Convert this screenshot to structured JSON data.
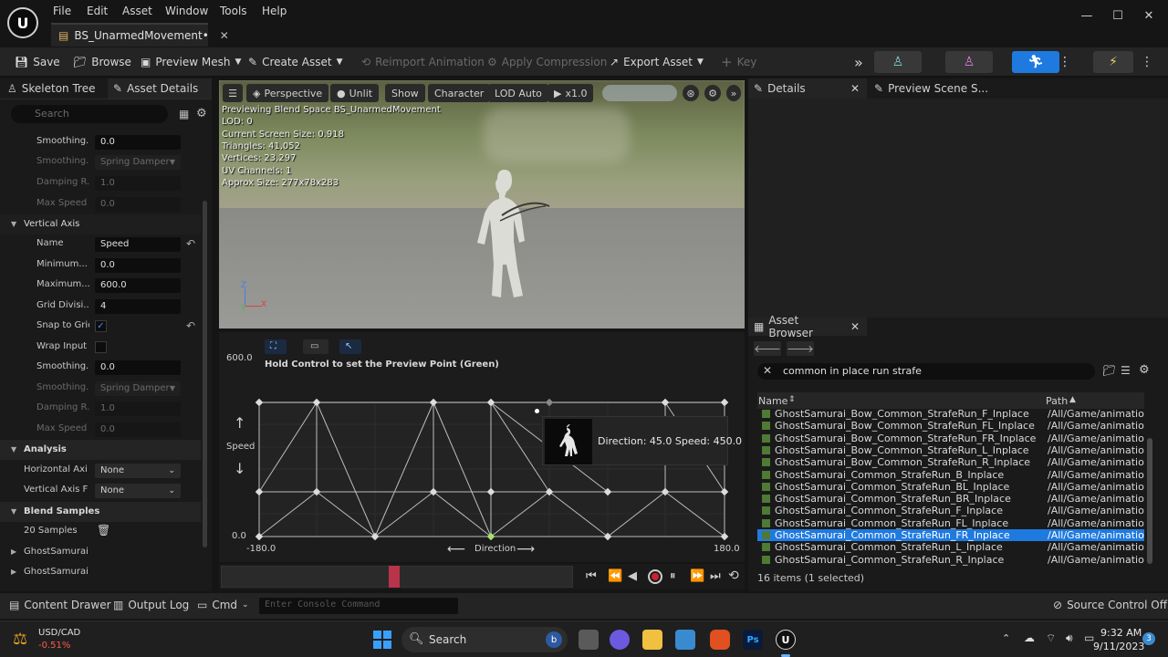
{
  "menu": [
    "File",
    "Edit",
    "Asset",
    "Window",
    "Tools",
    "Help"
  ],
  "tab": {
    "title": "BS_UnarmedMovement•"
  },
  "toolbar": {
    "save": "Save",
    "browse": "Browse",
    "preview_mesh": "Preview Mesh",
    "create_asset": "Create Asset",
    "reimport": "Reimport Animation",
    "apply_compression": "Apply Compression",
    "export_asset": "Export Asset",
    "key": "Key"
  },
  "left_panel": {
    "tab_skeleton": "Skeleton Tree",
    "tab_details": "Asset Details",
    "search_placeholder": "Search",
    "rows_top": [
      {
        "label": "Smoothing...",
        "value": "0.0",
        "dim": false,
        "kind": "num"
      },
      {
        "label": "Smoothing...",
        "value": "Spring Damper",
        "dim": true,
        "kind": "select"
      },
      {
        "label": "Damping R...",
        "value": "1.0",
        "dim": true,
        "kind": "num"
      },
      {
        "label": "Max Speed",
        "value": "0.0",
        "dim": true,
        "kind": "num"
      }
    ],
    "vertical_axis": {
      "title": "Vertical Axis",
      "name_label": "Name",
      "name_value": "Speed",
      "min_label": "Minimum...",
      "min_value": "0.0",
      "max_label": "Maximum...",
      "max_value": "600.0",
      "grid_label": "Grid Divisi...",
      "grid_value": "4",
      "snap_label": "Snap to Grid",
      "wrap_label": "Wrap Input",
      "smooth_label": "Smoothing...",
      "smooth_value": "0.0",
      "smooth2_label": "Smoothing...",
      "smooth2_value": "Spring Damper",
      "damping_label": "Damping R...",
      "damping_value": "1.0",
      "maxspeed_label": "Max Speed",
      "maxspeed_value": "0.0"
    },
    "analysis": {
      "title": "Analysis",
      "h_label": "Horizontal Axis I",
      "h_value": "None",
      "v_label": "Vertical Axis Fur",
      "v_value": "None"
    },
    "blend_samples": {
      "title": "Blend Samples",
      "count": "20 Samples",
      "item1": "GhostSamurai_(",
      "item2": "GhostSamurai_("
    }
  },
  "viewport": {
    "perspective": "Perspective",
    "unlit": "Unlit",
    "show": "Show",
    "character": "Character",
    "lod": "LOD Auto",
    "speed": "x1.0",
    "stats": [
      "Previewing Blend Space BS_UnarmedMovement",
      "LOD: 0",
      "Current Screen Size: 0.918",
      "Triangles: 41,052",
      "Vertices: 23,297",
      "UV Channels: 1",
      "Approx Size: 277x78x283"
    ],
    "axis_z": "Z",
    "axis_x": "X",
    "axis_y": "Y"
  },
  "blend_graph": {
    "hint": "Hold Control to set the Preview Point (Green)",
    "y_max": "600.0",
    "y_min": "0.0",
    "x_min": "-180.0",
    "x_max": "180.0",
    "y_axis_label": "Speed",
    "x_axis_label": "Direction",
    "tooltip": "Direction: 45.0  Speed: 450.0"
  },
  "details_panel": {
    "tab_details": "Details",
    "tab_preview": "Preview Scene S..."
  },
  "asset_browser": {
    "title": "Asset Browser",
    "search_value": "common in place run strafe",
    "col_name": "Name",
    "col_path": "Path",
    "rows": [
      {
        "name": "GhostSamurai_Bow_Common_StrafeRun_F_Inplace",
        "path": "/All/Game/animatio",
        "selected": false
      },
      {
        "name": "GhostSamurai_Bow_Common_StrafeRun_FL_Inplace",
        "path": "/All/Game/animatio",
        "selected": false
      },
      {
        "name": "GhostSamurai_Bow_Common_StrafeRun_FR_Inplace",
        "path": "/All/Game/animatio",
        "selected": false
      },
      {
        "name": "GhostSamurai_Bow_Common_StrafeRun_L_Inplace",
        "path": "/All/Game/animatio",
        "selected": false
      },
      {
        "name": "GhostSamurai_Bow_Common_StrafeRun_R_Inplace",
        "path": "/All/Game/animatio",
        "selected": false
      },
      {
        "name": "GhostSamurai_Common_StrafeRun_B_Inplace",
        "path": "/All/Game/animatio",
        "selected": false
      },
      {
        "name": "GhostSamurai_Common_StrafeRun_BL_Inplace",
        "path": "/All/Game/animatio",
        "selected": false
      },
      {
        "name": "GhostSamurai_Common_StrafeRun_BR_Inplace",
        "path": "/All/Game/animatio",
        "selected": false
      },
      {
        "name": "GhostSamurai_Common_StrafeRun_F_Inplace",
        "path": "/All/Game/animatio",
        "selected": false
      },
      {
        "name": "GhostSamurai_Common_StrafeRun_FL_Inplace",
        "path": "/All/Game/animatio",
        "selected": false
      },
      {
        "name": "GhostSamurai_Common_StrafeRun_FR_Inplace",
        "path": "/All/Game/animatio",
        "selected": true
      },
      {
        "name": "GhostSamurai_Common_StrafeRun_L_Inplace",
        "path": "/All/Game/animatio",
        "selected": false
      },
      {
        "name": "GhostSamurai_Common_StrafeRun_R_Inplace",
        "path": "/All/Game/animatio",
        "selected": false
      }
    ],
    "footer": "16 items (1 selected)"
  },
  "bottom_bar": {
    "content_drawer": "Content Drawer",
    "output_log": "Output Log",
    "cmd": "Cmd",
    "console_placeholder": "Enter Console Command",
    "source_control": "Source Control Off"
  },
  "taskbar": {
    "ticker": "USD/CAD",
    "ticker_change": "-0.51%",
    "search": "Search",
    "time": "9:32 AM",
    "date": "9/11/2023",
    "notif_count": "3"
  },
  "colors": {
    "accent": "#1f7ae0",
    "ticker_down": "#ff5a4d",
    "timeline_marker": "#b8344a"
  }
}
